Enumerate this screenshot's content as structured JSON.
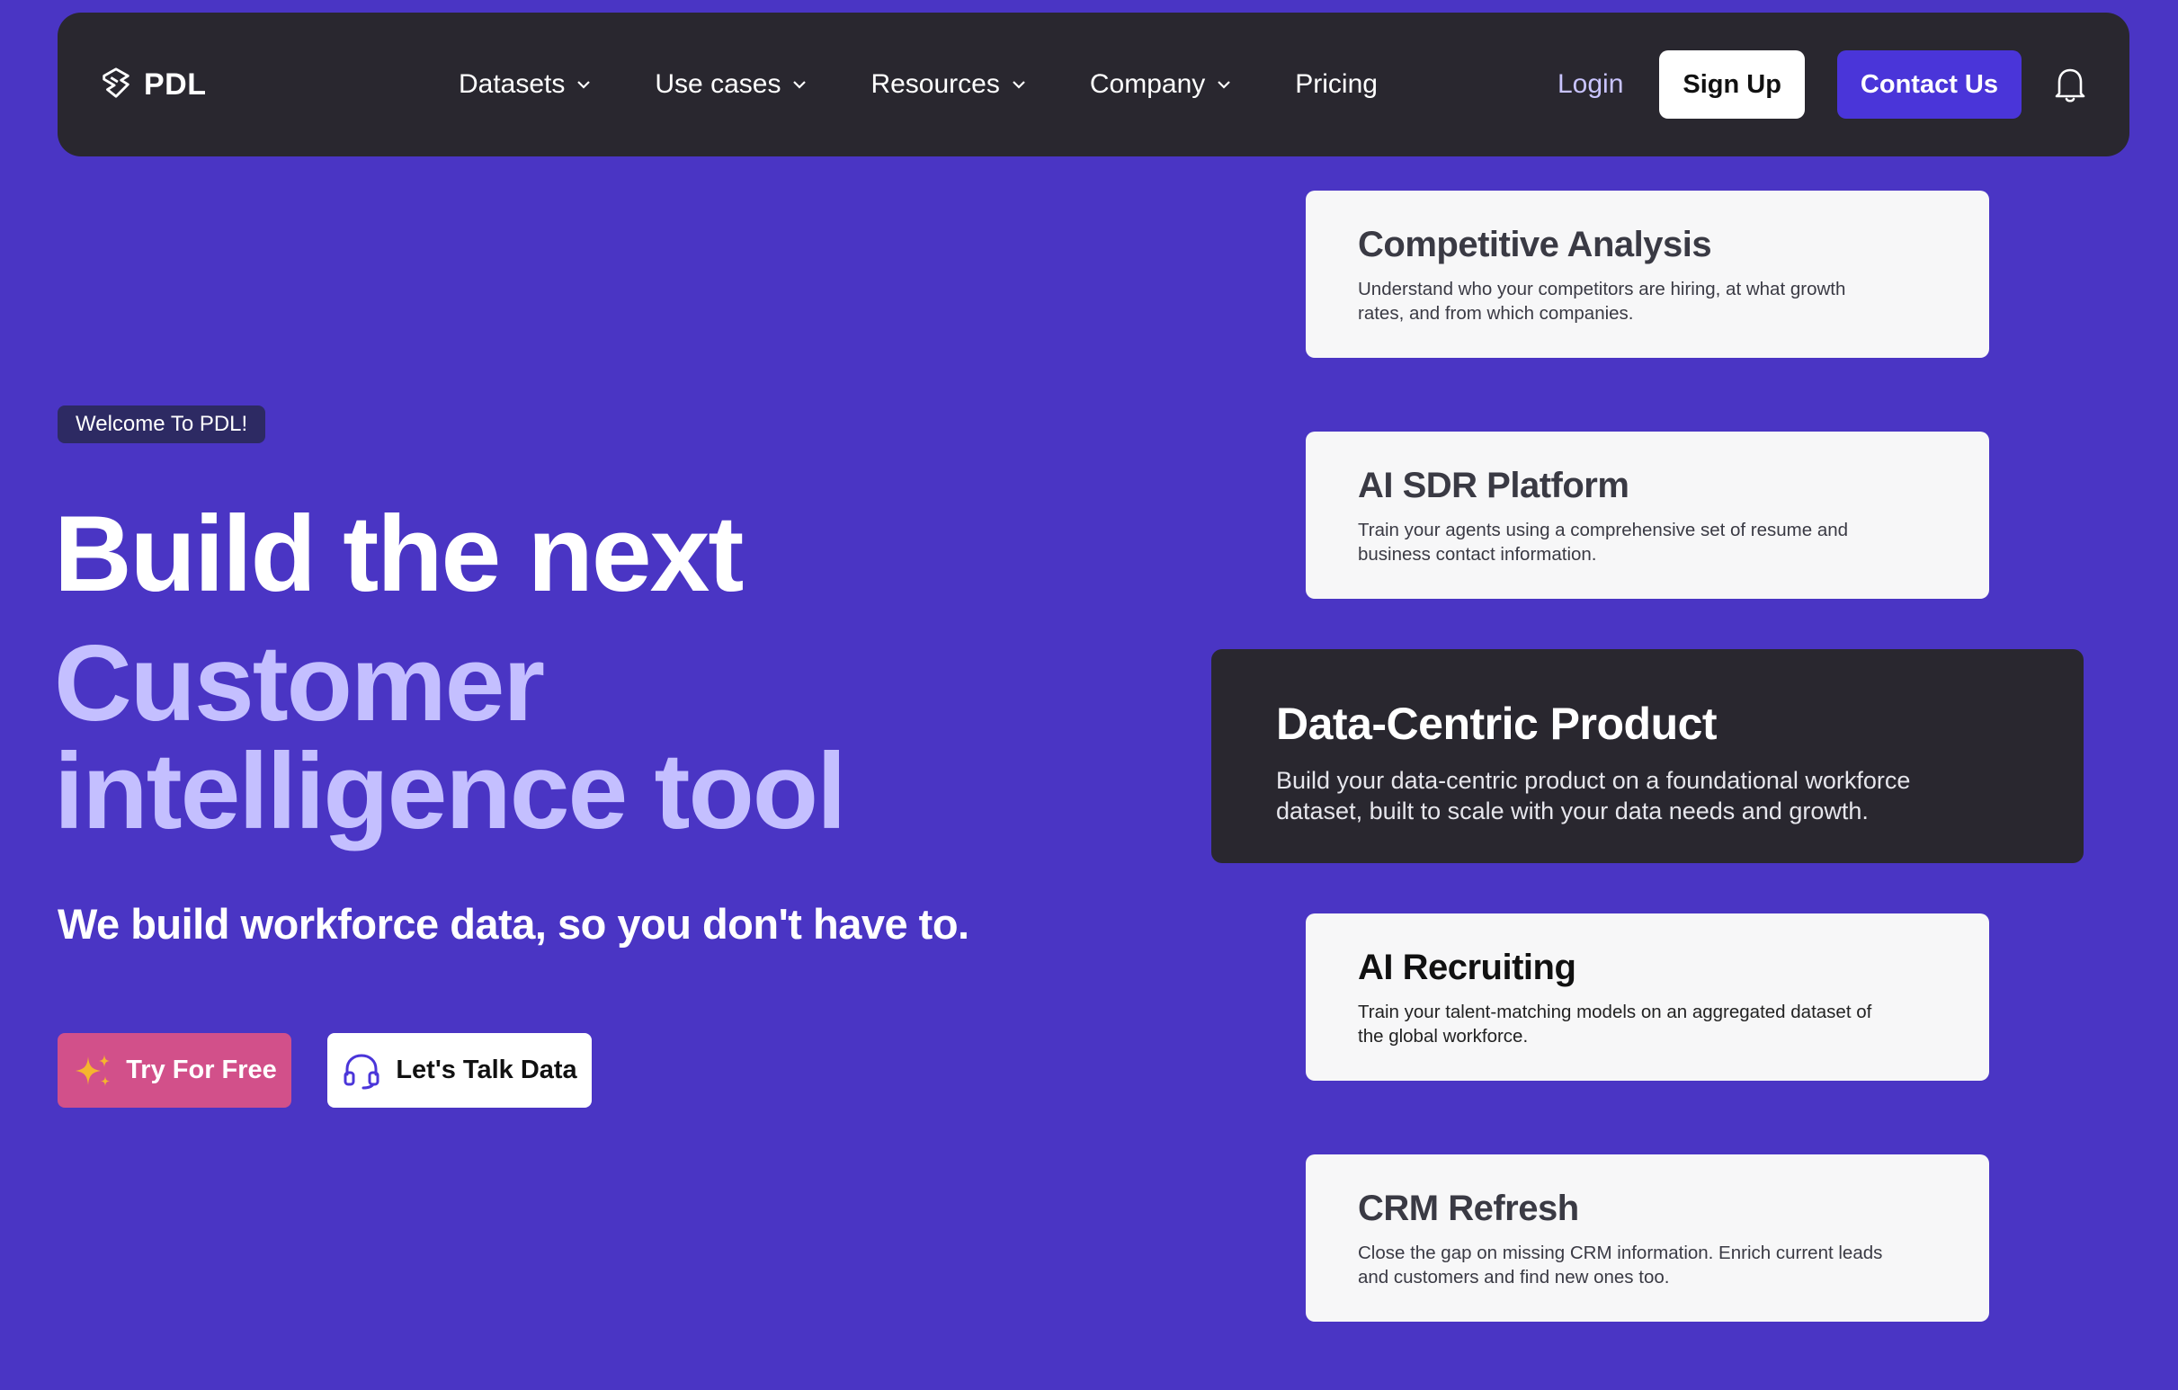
{
  "colors": {
    "background": "#4a35c4",
    "navbar": "#29272f",
    "accent_button": "#4a35d9",
    "try_button": "#d2508a",
    "headline_light": "#c4bfff"
  },
  "nav": {
    "logo_text": "PDL",
    "logo_icon": "pdl-logo-icon",
    "links": [
      {
        "label": "Datasets",
        "has_dropdown": true
      },
      {
        "label": "Use cases",
        "has_dropdown": true
      },
      {
        "label": "Resources",
        "has_dropdown": true
      },
      {
        "label": "Company",
        "has_dropdown": true
      },
      {
        "label": "Pricing",
        "has_dropdown": false
      }
    ],
    "login": "Login",
    "signup": "Sign Up",
    "contact": "Contact Us",
    "notification_icon": "bell-icon"
  },
  "hero": {
    "badge": "Welcome To PDL!",
    "headline_line1": "Build the next",
    "headline_line2": "Customer intelligence tool",
    "subheadline": "We build workforce data, so you don't have to.",
    "primary_button": {
      "label": "Try For Free",
      "icon": "sparkle-icon"
    },
    "secondary_button": {
      "label": "Let's Talk Data",
      "icon": "headset-icon"
    }
  },
  "use_cases": [
    {
      "title": "Competitive Analysis",
      "description": "Understand who your competitors are hiring, at what growth rates, and from which companies."
    },
    {
      "title": "AI SDR Platform",
      "description": "Train your agents using a comprehensive set of resume and business contact information."
    },
    {
      "title": "Data-Centric Product",
      "description": "Build your data-centric product on a foundational workforce dataset, built to scale with your data needs and growth.",
      "featured": true
    },
    {
      "title": "AI Recruiting",
      "description": "Train your talent-matching models on an aggregated dataset of the global workforce."
    },
    {
      "title": "CRM Refresh",
      "description": "Close the gap on missing CRM information. Enrich current leads and customers and find new ones too."
    }
  ]
}
